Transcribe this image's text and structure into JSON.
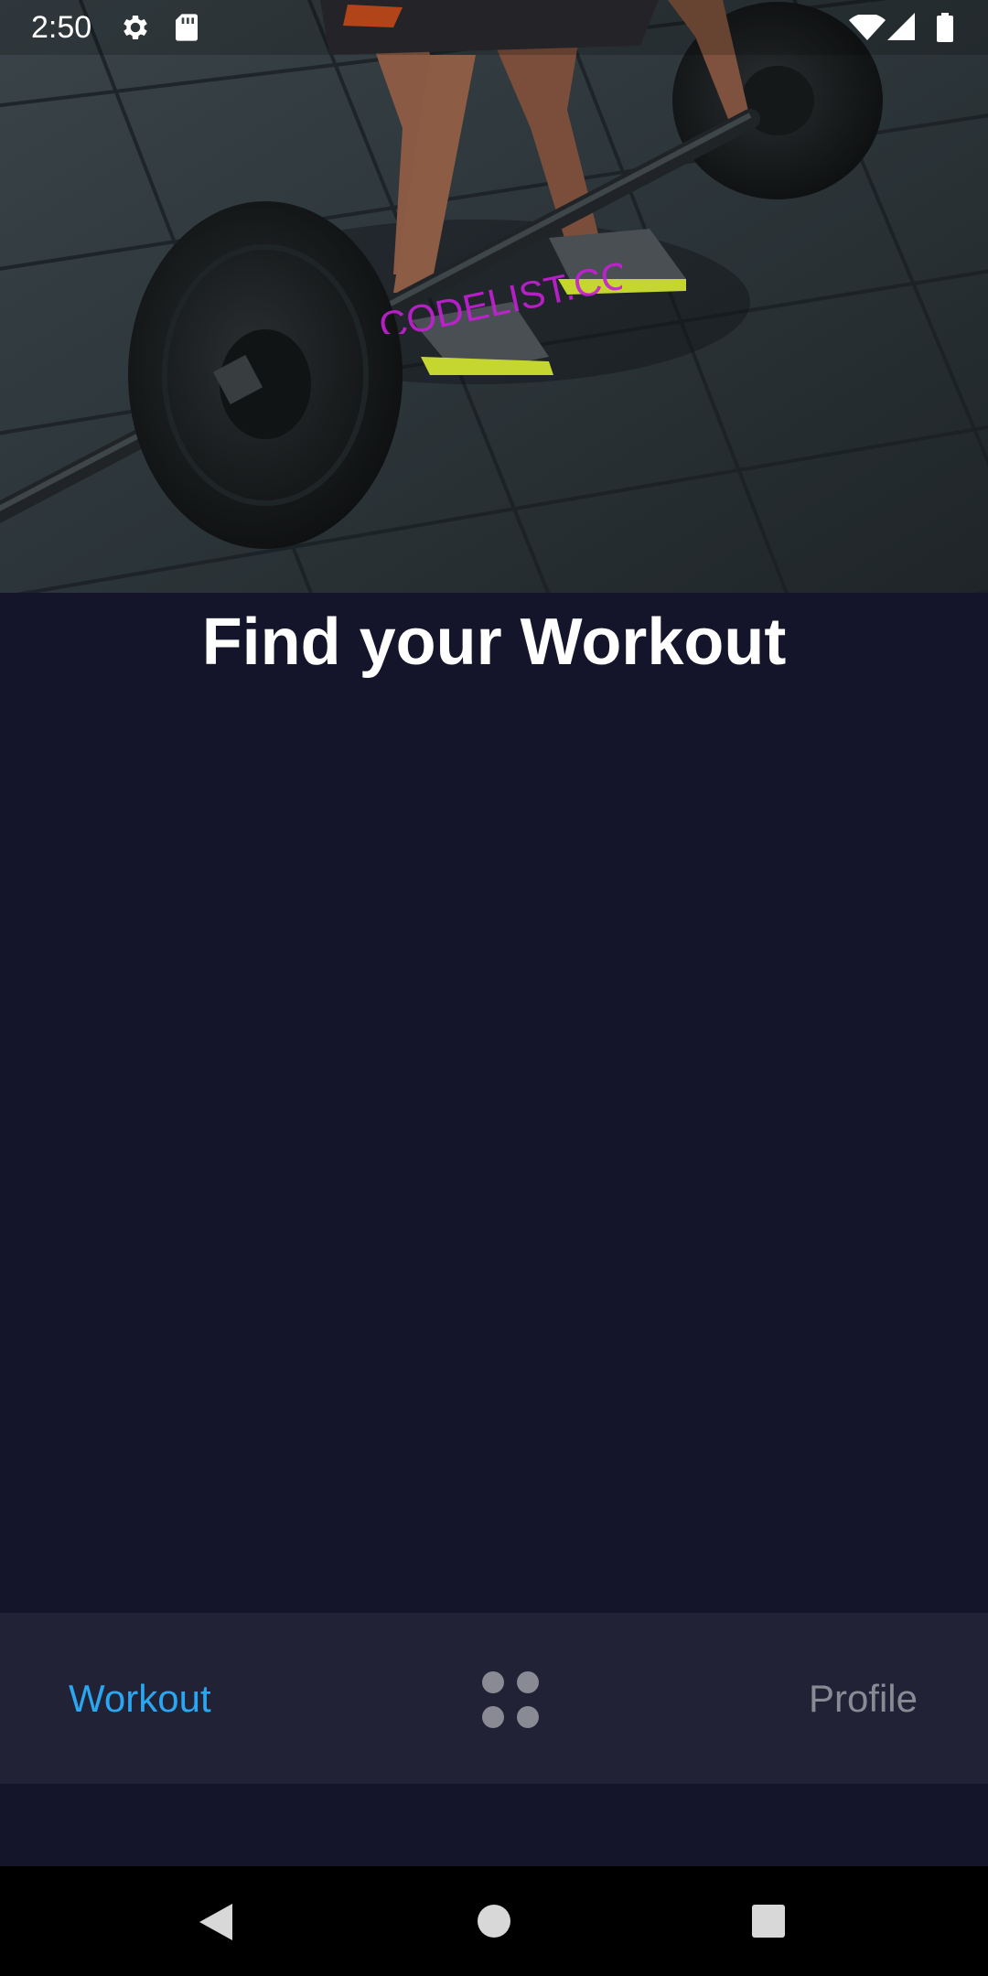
{
  "status_bar": {
    "time": "2:50",
    "icons": [
      "gear-icon",
      "sd-card-icon",
      "wifi-icon",
      "signal-icon",
      "battery-icon"
    ]
  },
  "hero": {
    "image": "weightlifter-deadlift-photo",
    "watermark": "CODELIST.CC"
  },
  "main": {
    "title": "Find your Workout"
  },
  "bottom_nav": {
    "workout_label": "Workout",
    "center_icon": "grid-dots-icon",
    "profile_label": "Profile"
  },
  "system_nav": {
    "icons": [
      "back-icon",
      "home-icon",
      "recents-icon"
    ]
  },
  "colors": {
    "background": "#14142a",
    "nav_background": "#222236",
    "active_tab": "#2ba6f0",
    "inactive_tab": "#8a8a95",
    "title": "#ffffff",
    "watermark": "#c71fd6"
  }
}
